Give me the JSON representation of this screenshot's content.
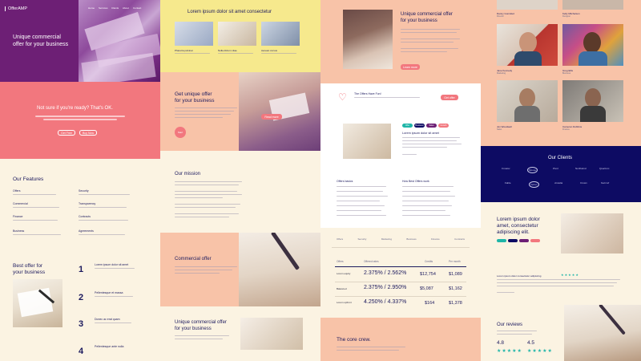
{
  "brand": "OfferAMP",
  "nav": [
    "Home",
    "Services",
    "Clients",
    "About",
    "Contact"
  ],
  "hero": {
    "title_line1": "Unique commercial",
    "title_line2": "offer for your business"
  },
  "cta": {
    "title": "Not sure if you're ready? That's OK.",
    "btn1": "Get Free",
    "btn2": "Buy Now"
  },
  "features": {
    "title": "Our Features",
    "items": [
      "Offers",
      "Security",
      "Commercial",
      "Transparency",
      "Finance",
      "Contracts",
      "Business",
      "Agreements"
    ]
  },
  "best": {
    "title_line1": "Best offer for",
    "title_line2": "your business",
    "numbers": [
      "1",
      "2",
      "3",
      "4"
    ],
    "steps": [
      "Lorem ipsum dolor sit amet",
      "Pellentesque et massa",
      "Donec ac erat quam",
      "Pellentesque ante nulla"
    ]
  },
  "col2": {
    "headline": "Lorem ipsum dolor sit amet consectetur",
    "cards": [
      "Pharetra pulvinar",
      "Nulla dictum vitae",
      "Aenean cursus"
    ],
    "get_title_line1": "Get unique offer",
    "get_title_line2": "for your business",
    "get_btn": "Start",
    "overlay_btn": "Read more",
    "mission": "Our mission",
    "commercial": "Commercial offer",
    "unique_line1": "Unique commercial offer",
    "unique_line2": "for your business"
  },
  "col3": {
    "hero_line1": "Unique commercial offer",
    "hero_line2": "for your business",
    "hero_btn": "Learn more",
    "box_title": "The Offers Have Fun!",
    "box_btn": "Get offer",
    "tags": [
      "Offer",
      "Business",
      "Sales",
      "Growth"
    ],
    "article": "Lorem ipsum dolor sit amet",
    "list1": "Offers basics",
    "list2": "How Best Offers work",
    "tabs": [
      "Offers",
      "Security",
      "Marketing",
      "Business",
      "Finance",
      "Contracts"
    ],
    "table": {
      "headers": [
        "Offers",
        "Offered rates",
        "Credits",
        "Per month"
      ],
      "rows": [
        [
          "Lorem equity",
          "2.375% / 2.562%",
          "$12,754",
          "$1,089"
        ],
        [
          "Balanced",
          "2.375% / 2.950%",
          "$5,087",
          "$1,162"
        ],
        [
          "Lorem upfront",
          "4.250% / 4.337%",
          "$164",
          "$1,378"
        ]
      ]
    },
    "core": "The core crew."
  },
  "col4": {
    "team": [
      [
        "Danny Gonzalez",
        "Director"
      ],
      [
        "Kelly Mitchelson",
        "Designer"
      ],
      [
        "Jane Kennedy",
        "Marketing"
      ],
      [
        "Greg Ellis",
        "Business"
      ],
      [
        "Jon Woodwell",
        "Sales"
      ],
      [
        "Cameron Dobbins",
        "Finance"
      ]
    ],
    "clients": "Our Clients",
    "logos": [
      "Coretex",
      "Moose",
      "Pivot",
      "Northwind",
      "Quantum",
      "Fable",
      "Vertex",
      "Arcadia",
      "Crown",
      "Summit"
    ],
    "lorem_line1": "Lorem ipsum dolor",
    "lorem_line2": "amet, consectetur",
    "lorem_line3": "adipiscing elit.",
    "quote": "Lorem ipsum dolor consectetur adipiscing",
    "reviews": "Our reviews",
    "ratings": [
      "4.8",
      "4.5"
    ]
  },
  "colors": {
    "purple": "#6d1f75",
    "salmon": "#f2777e",
    "cream": "#fbf3e2",
    "yellow": "#f6e98d",
    "peach": "#f8c3a8",
    "navy": "#0d0b63",
    "teal": "#1fb5a8"
  }
}
